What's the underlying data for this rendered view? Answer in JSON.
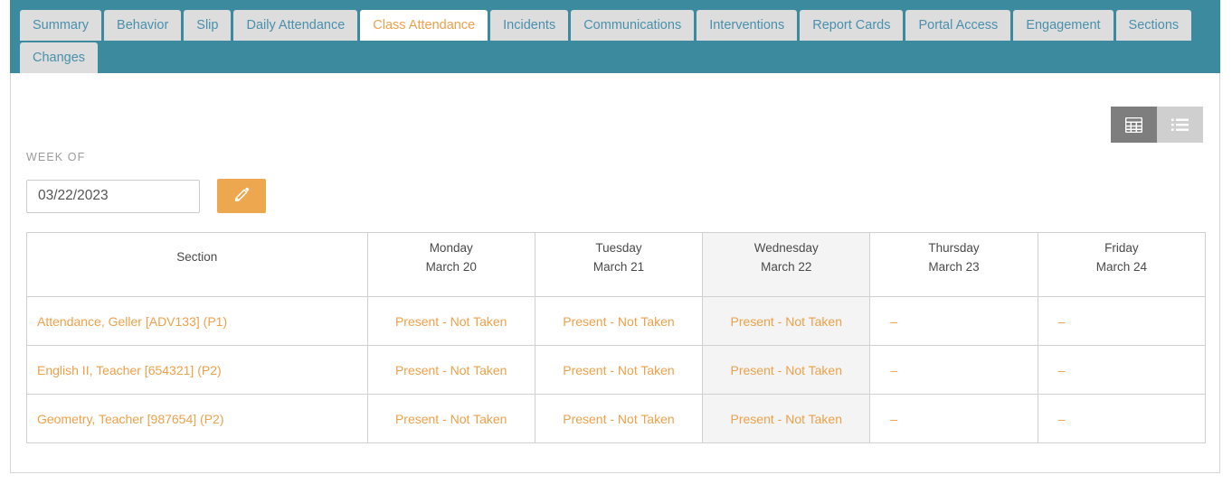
{
  "theme": {
    "teal": "#3b8a9e",
    "orange": "#eda14a",
    "tab_blue": "#4a90ac",
    "tab_grey": "#dddddd",
    "highlight_grey": "#f4f4f4"
  },
  "tabs": [
    {
      "label": "Summary",
      "active": false
    },
    {
      "label": "Behavior",
      "active": false
    },
    {
      "label": "Slip",
      "active": false
    },
    {
      "label": "Daily Attendance",
      "active": false
    },
    {
      "label": "Class Attendance",
      "active": true
    },
    {
      "label": "Incidents",
      "active": false
    },
    {
      "label": "Communications",
      "active": false
    },
    {
      "label": "Interventions",
      "active": false
    },
    {
      "label": "Report Cards",
      "active": false
    },
    {
      "label": "Portal Access",
      "active": false
    },
    {
      "label": "Engagement",
      "active": false
    },
    {
      "label": "Sections",
      "active": false
    },
    {
      "label": "Changes",
      "active": false
    }
  ],
  "view_toggle": {
    "grid": {
      "icon": "grid-view-icon",
      "active": true
    },
    "list": {
      "icon": "list-view-icon",
      "active": false
    }
  },
  "week_of": {
    "label": "WEEK OF",
    "value": "03/22/2023",
    "placeholder": "mm/dd/yyyy",
    "edit_icon": "pencil-icon"
  },
  "table": {
    "columns": [
      {
        "key": "section",
        "title": "Section",
        "day": "",
        "date": "",
        "highlight": false
      },
      {
        "key": "monday",
        "title": "",
        "day": "Monday",
        "date": "March 20",
        "highlight": false
      },
      {
        "key": "tuesday",
        "title": "",
        "day": "Tuesday",
        "date": "March 21",
        "highlight": false
      },
      {
        "key": "wednesday",
        "title": "",
        "day": "Wednesday",
        "date": "March 22",
        "highlight": true
      },
      {
        "key": "thursday",
        "title": "",
        "day": "Thursday",
        "date": "March 23",
        "highlight": false
      },
      {
        "key": "friday",
        "title": "",
        "day": "Friday",
        "date": "March 24",
        "highlight": false
      }
    ],
    "rows": [
      {
        "section": "Attendance, Geller [ADV133] (P1)",
        "monday": "Present - Not Taken",
        "tuesday": "Present - Not Taken",
        "wednesday": "Present - Not Taken",
        "thursday": "–",
        "friday": "–"
      },
      {
        "section": "English II, Teacher [654321] (P2)",
        "monday": "Present - Not Taken",
        "tuesday": "Present - Not Taken",
        "wednesday": "Present - Not Taken",
        "thursday": "–",
        "friday": "–"
      },
      {
        "section": "Geometry, Teacher [987654] (P2)",
        "monday": "Present - Not Taken",
        "tuesday": "Present - Not Taken",
        "wednesday": "Present - Not Taken",
        "thursday": "–",
        "friday": "–"
      }
    ]
  }
}
